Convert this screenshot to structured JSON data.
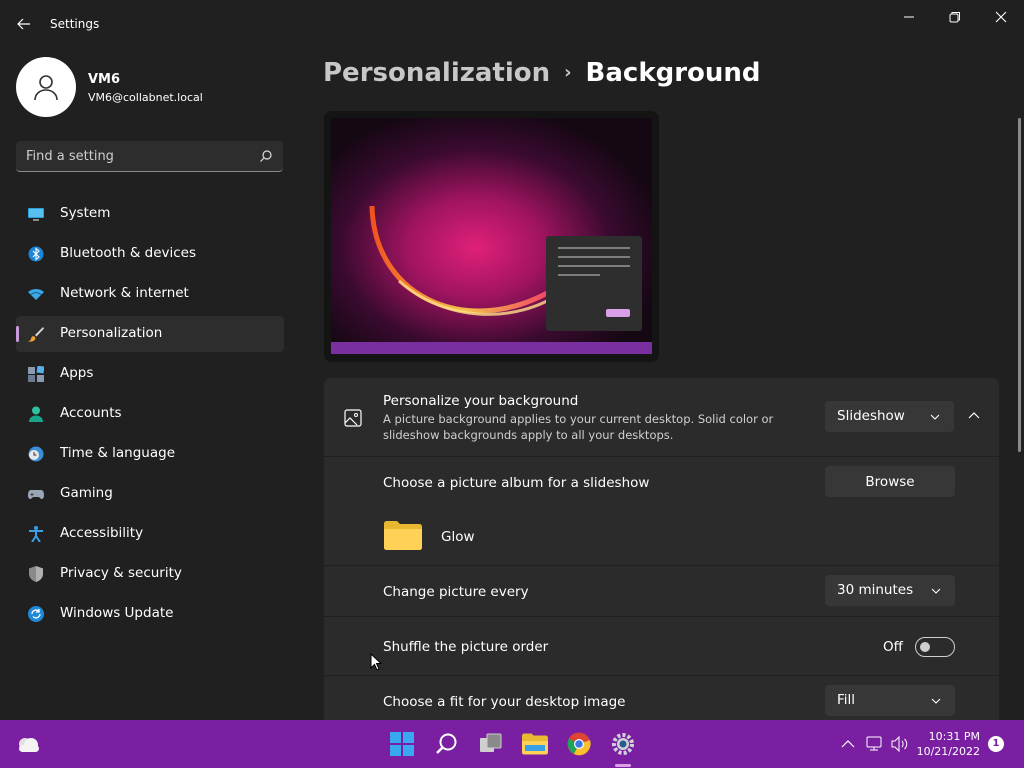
{
  "window": {
    "title": "Settings"
  },
  "profile": {
    "name": "VM6",
    "email": "VM6@collabnet.local"
  },
  "search": {
    "placeholder": "Find a setting"
  },
  "nav": {
    "items": [
      {
        "label": "System",
        "icon": "monitor-icon"
      },
      {
        "label": "Bluetooth & devices",
        "icon": "bluetooth-icon"
      },
      {
        "label": "Network & internet",
        "icon": "wifi-icon"
      },
      {
        "label": "Personalization",
        "icon": "brush-icon",
        "active": true
      },
      {
        "label": "Apps",
        "icon": "apps-icon"
      },
      {
        "label": "Accounts",
        "icon": "person-icon"
      },
      {
        "label": "Time & language",
        "icon": "clock-globe-icon"
      },
      {
        "label": "Gaming",
        "icon": "gamepad-icon"
      },
      {
        "label": "Accessibility",
        "icon": "accessibility-icon"
      },
      {
        "label": "Privacy & security",
        "icon": "shield-icon"
      },
      {
        "label": "Windows Update",
        "icon": "update-icon"
      }
    ]
  },
  "header": {
    "parent": "Personalization",
    "separator": "›",
    "current": "Background"
  },
  "background": {
    "personalize_title": "Personalize your background",
    "personalize_desc": "A picture background applies to your current desktop. Solid color or slideshow backgrounds apply to all your desktops.",
    "personalize_value": "Slideshow",
    "album_label": "Choose a picture album for a slideshow",
    "browse_label": "Browse",
    "album_name": "Glow",
    "change_label": "Change picture every",
    "change_value": "30 minutes",
    "shuffle_label": "Shuffle the picture order",
    "shuffle_state": "Off",
    "fit_label": "Choose a fit for your desktop image",
    "fit_value": "Fill"
  },
  "taskbar": {
    "time": "10:31 PM",
    "date": "10/21/2022",
    "notification_count": "1",
    "accent": "#7a1fa2"
  },
  "colors": {
    "nav_indicator": "#c89ad9",
    "app_background": "#202020",
    "card_background": "#2b2b2b"
  }
}
